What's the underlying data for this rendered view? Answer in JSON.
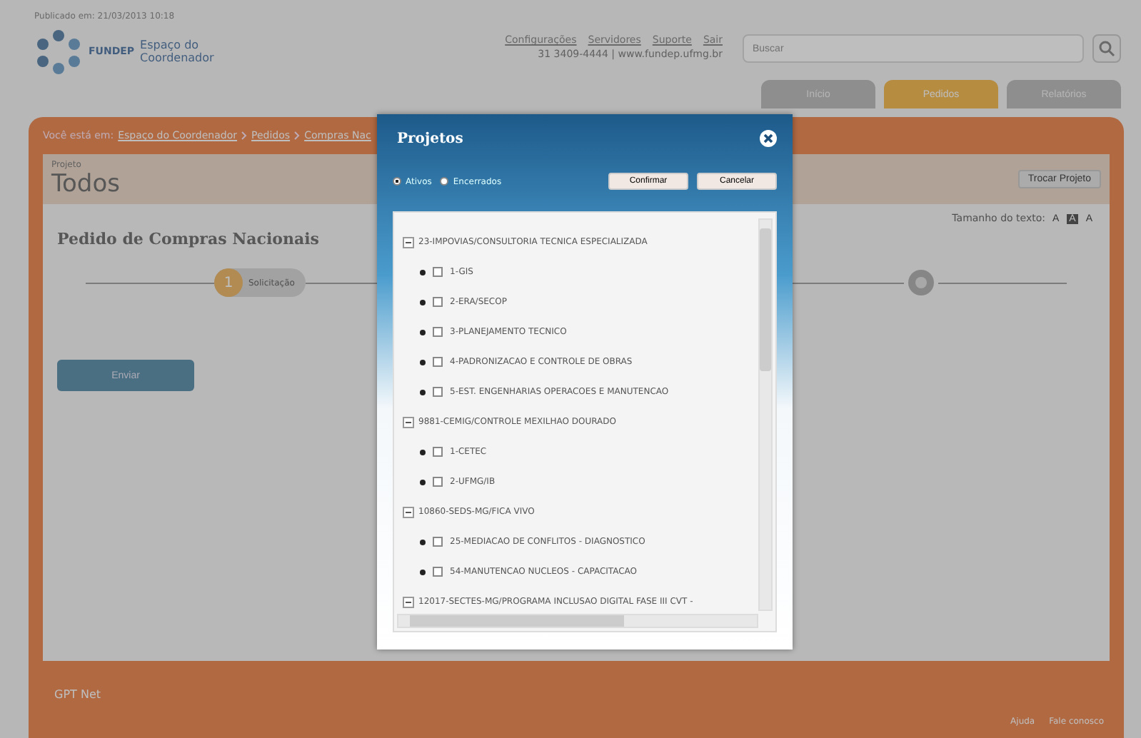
{
  "published": "Publicado em: 21/03/2013 10:18",
  "logo": {
    "brand": "FUNDEP",
    "line1": "Espaço do",
    "line2": "Coordenador"
  },
  "top_links": [
    "Configurações",
    "Servidores",
    "Suporte",
    "Sair"
  ],
  "contact": "31 3409-4444 | www.fundep.ufmg.br",
  "search": {
    "placeholder": "Buscar"
  },
  "tabs": [
    {
      "label": "Início",
      "selected": false
    },
    {
      "label": "Pedidos",
      "selected": true
    },
    {
      "label": "Relatórios",
      "selected": false
    }
  ],
  "breadcrumb": {
    "prefix": "Você está em:",
    "links": [
      "Espaço do Coordenador",
      "Pedidos",
      "Compras Nac"
    ]
  },
  "project": {
    "label": "Projeto",
    "value": "Todos",
    "button": "Trocar Projeto"
  },
  "text_size": {
    "label": "Tamanho do texto:",
    "options": [
      {
        "label": "A",
        "selected": false
      },
      {
        "label": "A",
        "selected": true
      },
      {
        "label": "A",
        "selected": false
      }
    ]
  },
  "form_title": "Pedido de Compras Nacionais",
  "steps": [
    {
      "kind": "numbered",
      "number": "1",
      "label": "Solicitação",
      "active": true
    },
    {
      "kind": "icon",
      "active": false
    }
  ],
  "send_button": "Enviar",
  "footer": {
    "logo": "GPT Net",
    "links": [
      "Ajuda",
      "Fale conosco"
    ]
  },
  "modal": {
    "title": "Projetos",
    "filters": [
      {
        "label": "Ativos",
        "selected": true
      },
      {
        "label": "Encerrados",
        "selected": false
      }
    ],
    "buttons": [
      "Confirmar",
      "Cancelar"
    ],
    "groups": [
      {
        "label": "23-IMPOVIAS/CONSULTORIA TECNICA ESPECIALIZADA",
        "expanded": true,
        "children": [
          {
            "label": "1-GIS",
            "checked": false
          },
          {
            "label": "2-ERA/SECOP",
            "checked": false
          },
          {
            "label": "3-PLANEJAMENTO TECNICO",
            "checked": false
          },
          {
            "label": "4-PADRONIZACAO E CONTROLE DE OBRAS",
            "checked": false
          },
          {
            "label": "5-EST. ENGENHARIAS OPERACOES E MANUTENCAO",
            "checked": false
          }
        ]
      },
      {
        "label": "9881-CEMIG/CONTROLE MEXILHAO DOURADO",
        "expanded": true,
        "children": [
          {
            "label": "1-CETEC",
            "checked": false
          },
          {
            "label": "2-UFMG/IB",
            "checked": false
          }
        ]
      },
      {
        "label": "10860-SEDS-MG/FICA VIVO",
        "expanded": true,
        "children": [
          {
            "label": "25-MEDIACAO DE CONFLITOS - DIAGNOSTICO",
            "checked": false
          },
          {
            "label": "54-MANUTENCAO NUCLEOS - CAPACITACAO",
            "checked": false
          }
        ]
      },
      {
        "label": "12017-SECTES-MG/PROGRAMA INCLUSAO DIGITAL FASE III CVT -",
        "expanded": true
      }
    ]
  }
}
